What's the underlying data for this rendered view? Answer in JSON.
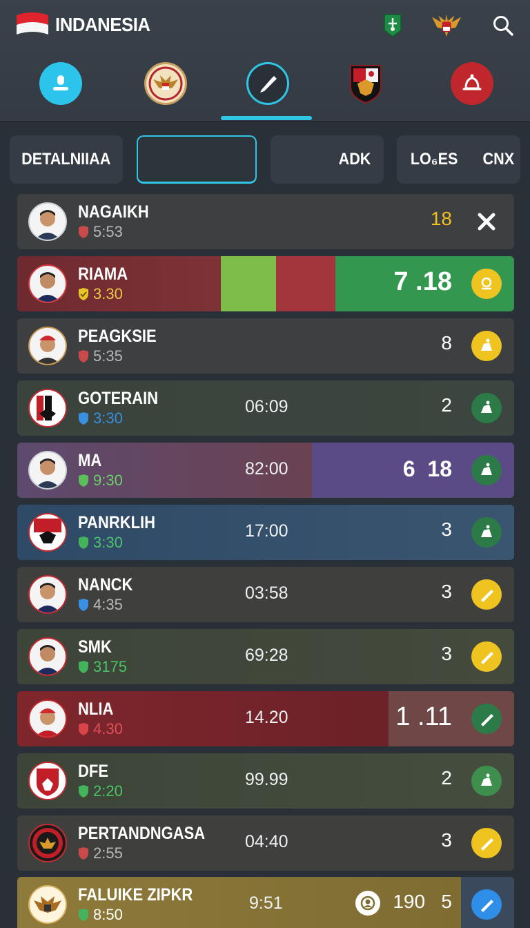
{
  "header": {
    "title": "INDANESIA",
    "icons": [
      "indonesia-flag-icon",
      "green-badge-icon",
      "garuda-emblem-icon",
      "search-icon"
    ]
  },
  "tabs": [
    {
      "icon": "profile-icon",
      "color": "#2cc4ea"
    },
    {
      "icon": "garuda-crest-icon",
      "color": "#f3e2c0"
    },
    {
      "icon": "pen-icon",
      "color": "#2a3038",
      "active": true
    },
    {
      "icon": "club-crest-icon",
      "color": "#b01e2a"
    },
    {
      "icon": "bell-icon",
      "color": "#c0272d"
    }
  ],
  "filters": [
    {
      "label": "DETALNIIAA"
    },
    {
      "label": ""
    },
    {
      "label": "ADK"
    },
    {
      "label": "LO₆ES"
    },
    {
      "label": "CNX"
    }
  ],
  "rows": [
    {
      "name": "NAGAIKH",
      "sub": "5:53",
      "sub_color": "#c84a4a",
      "time": "",
      "score": "18",
      "score_color": "#f3c11b",
      "action": "close-icon",
      "action_color": "transparent"
    },
    {
      "name": "RIAMA",
      "sub": "3.30",
      "sub_color": "#e8c52a",
      "time": "",
      "score": "7 .18",
      "score_color": "#ffffff",
      "action": "badge-icon",
      "action_color": "#f0c420"
    },
    {
      "name": "PEAGKSIE",
      "sub": "5:35",
      "sub_color": "#c84a4a",
      "time": "",
      "score": "8",
      "score_color": "#ffffff",
      "action": "whistle-icon",
      "action_color": "#f0c420"
    },
    {
      "name": "GOTERAIN",
      "sub": "3:30",
      "sub_color": "#3a8fe0",
      "time": "06:09",
      "score": "2",
      "score_color": "#ffffff",
      "action": "whistle-icon",
      "action_color": "#2b7a47"
    },
    {
      "name": "MA",
      "sub": "9:30",
      "sub_color": "#5cbf5c",
      "time": "82:00",
      "score": "6  18",
      "score_color": "#ffffff",
      "action": "whistle-icon",
      "action_color": "#2b7a47"
    },
    {
      "name": "PANRKLIH",
      "sub": "3:30",
      "sub_color": "#44b35c",
      "time": "17:00",
      "score": "3",
      "score_color": "#ffffff",
      "action": "whistle-icon",
      "action_color": "#2b7a47"
    },
    {
      "name": "NANCK",
      "sub": "4:35",
      "sub_color": "#3a8fe0",
      "time": "03:58",
      "score": "3",
      "score_color": "#ffffff",
      "action": "pen-icon",
      "action_color": "#f0c420"
    },
    {
      "name": "SMK",
      "sub": "3175",
      "sub_color": "#44b35c",
      "time": "69:28",
      "score": "3",
      "score_color": "#ffffff",
      "action": "pen-icon",
      "action_color": "#f0c420"
    },
    {
      "name": "NLIA",
      "sub": "4.30",
      "sub_color": "#d8444a",
      "time": "14.20",
      "score": "1 .11",
      "score_color": "#ffffff",
      "action": "pen-icon",
      "action_color": "#2b7a47"
    },
    {
      "name": "DFE",
      "sub": "2:20",
      "sub_color": "#44b35c",
      "time": "99.99",
      "score": "2",
      "score_color": "#ffffff",
      "action": "whistle-icon",
      "action_color": "#3e8f4e"
    },
    {
      "name": "PERTANDNGASA",
      "sub": "2:55",
      "sub_color": "#c84a4a",
      "time": "04:40",
      "score": "3",
      "score_color": "#ffffff",
      "action": "pen-icon",
      "action_color": "#f0c420"
    },
    {
      "name": "FALUIKE ZIPKR",
      "sub": "8:50",
      "sub_color": "#44b35c",
      "time": "9:51",
      "score": "190   5",
      "score_color": "#ffffff",
      "action": "pen-icon",
      "action_color": "#2f8fe8"
    }
  ]
}
